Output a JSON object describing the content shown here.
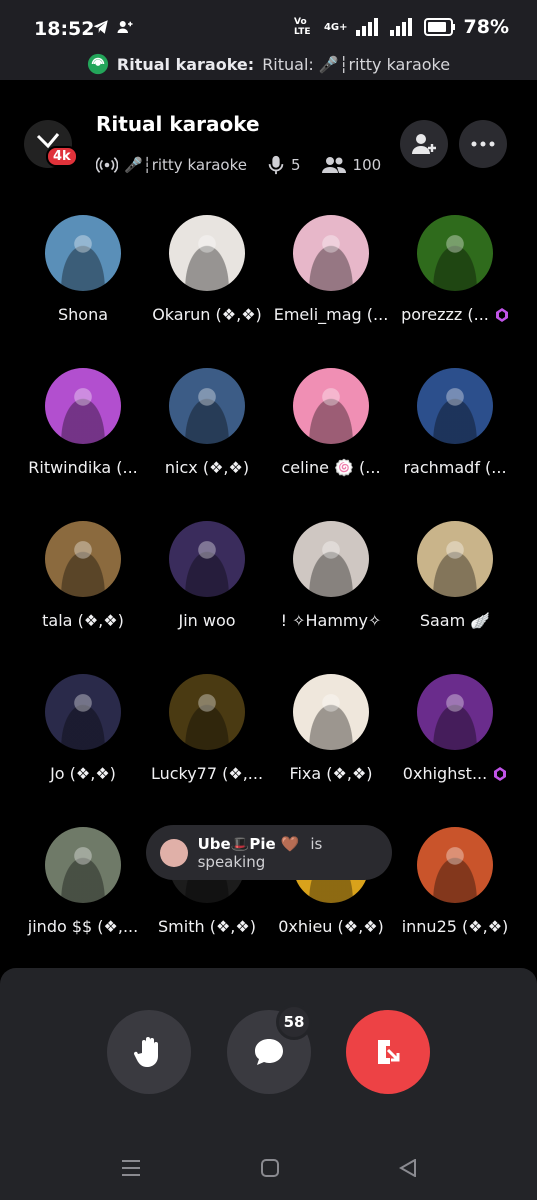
{
  "status_bar": {
    "time": "18:52",
    "battery": "78%",
    "net_label": "Vo LTE",
    "net_type": "4G+"
  },
  "notification": {
    "title": "Ritual karaoke:",
    "text": "Ritual: 🎤┆ritty karaoke"
  },
  "header": {
    "title": "Ritual karaoke",
    "badge": "4k",
    "channel": "🎤┆ritty karaoke",
    "speakers": "5",
    "listeners": "100"
  },
  "participants": [
    {
      "name": "Shona",
      "color": "#5a8fb8",
      "gem": false
    },
    {
      "name": "Okarun (❖,❖)",
      "color": "#e8e4e0",
      "gem": false
    },
    {
      "name": "Emeli_mag (...",
      "color": "#e7b7c9",
      "gem": false
    },
    {
      "name": "porezzz (...",
      "color": "#2f6b1c",
      "gem": true
    },
    {
      "name": "Ritwindika (...",
      "color": "#b24fcf",
      "gem": false
    },
    {
      "name": "nicx (❖,❖)",
      "color": "#3c5c86",
      "gem": false
    },
    {
      "name": "celine 🍥 (...",
      "color": "#f08fb4",
      "gem": false
    },
    {
      "name": "rachmadf (...",
      "color": "#2c4f8c",
      "gem": false
    },
    {
      "name": "tala (❖,❖)",
      "color": "#8b6a3e",
      "gem": false
    },
    {
      "name": "Jin woo",
      "color": "#3a2c5c",
      "gem": false
    },
    {
      "name": "! ✧Hammy✧",
      "color": "#cfc7c2",
      "gem": false
    },
    {
      "name": "Saam 🪽",
      "color": "#c9b48a",
      "gem": false
    },
    {
      "name": "Jo (❖,❖)",
      "color": "#2a2a4a",
      "gem": false
    },
    {
      "name": "Lucky77 (❖,...",
      "color": "#4a3a12",
      "gem": false
    },
    {
      "name": "Fixa (❖,❖)",
      "color": "#efe7dc",
      "gem": false
    },
    {
      "name": "0xhighst...",
      "color": "#6a2c8c",
      "gem": true
    },
    {
      "name": "jindo $$ (❖,...",
      "color": "#6f7a68",
      "gem": false
    },
    {
      "name": "Smith (❖,❖)",
      "color": "#1c1c1c",
      "gem": false
    },
    {
      "name": "0xhieu (❖,❖)",
      "color": "#d9a21b",
      "gem": false
    },
    {
      "name": "innu25 (❖,❖)",
      "color": "#c9542b",
      "gem": false
    }
  ],
  "toast": {
    "user": "Ube🎩Pie 🤎",
    "text": "is speaking"
  },
  "controls": {
    "chat_count": "58"
  },
  "colors": {
    "accent_red": "#ed4245",
    "gem_purple": "#c154e8"
  }
}
